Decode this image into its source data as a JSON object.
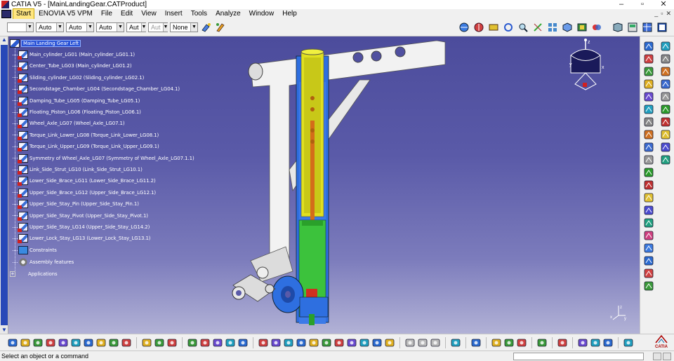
{
  "window": {
    "title": "CATIA V5 - [MainLandingGear.CATProduct]",
    "controls": [
      "–",
      "▫",
      "✕"
    ]
  },
  "menu": {
    "items": [
      "Start",
      "ENOVIA V5 VPM",
      "File",
      "Edit",
      "View",
      "Insert",
      "Tools",
      "Analyze",
      "Window",
      "Help"
    ],
    "doc_controls": [
      "_",
      "▫",
      "✕"
    ]
  },
  "properties_toolbar": {
    "color_combo": "",
    "transparency_combo": "Auto",
    "line_thickness_combo": "Auto",
    "line_type_combo": "Auto",
    "layer_combo": "Aut",
    "render_combo": "Aut",
    "layer_name_combo": "None"
  },
  "tree": {
    "root": "Main Landing Gear Left",
    "items": [
      "Main_cylinder_LG01 (Main_cylinder_LG01.1)",
      "Center_Tube_LG03 (Main_cylinder_LG01.2)",
      "Sliding_cylinder_LG02 (Sliding_cylinder_LG02.1)",
      "Secondstage_Chamber_LG04 (Secondstage_Chamber_LG04.1)",
      "Damping_Tube_LG05 (Damping_Tube_LG05.1)",
      "Floating_Piston_LG06 (Floating_Piston_LG06.1)",
      "Wheel_Axle_LG07 (Wheel_Axle_LG07.1)",
      "Torque_Link_Lower_LG08 (Torque_Link_Lower_LG08.1)",
      "Torque_Link_Upper_LG09 (Torque_Link_Upper_LG09.1)",
      "Symmetry of Wheel_Axle_LG07 (Symmetry of Wheel_Axle_LG07.1.1)",
      "Link_Side_Strut_LG10 (Link_Side_Strut_LG10.1)",
      "Lower_Side_Brace_LG11 (Lower_Side_Brace_LG11.2)",
      "Upper_Side_Brace_LG12 (Upper_Side_Brace_LG12.1)",
      "Upper_Side_Stay_Pin (Upper_Side_Stay_Pin.1)",
      "Upper_Side_Stay_Pivot (Upper_Side_Stay_Pivot.1)",
      "Upper_Side_Stay_LG14 (Upper_Side_Stay_LG14.2)",
      "Lower_Lock_Stay_LG13 (Lower_Lock_Stay_LG13.1)"
    ],
    "constraints": "Constraints",
    "assembly_features": "Assembly features",
    "applications": "Applications"
  },
  "compass": {
    "axis_x": "x",
    "axis_y": "y",
    "axis_z": "z"
  },
  "viewport_axis": {
    "x": "x",
    "y": "y",
    "z": "z"
  },
  "status": {
    "message": "Select an object or a command",
    "command_input": ""
  },
  "logo_text": "CATIA",
  "colors": {
    "viewport_top": "#4c4c9c",
    "viewport_bottom": "#b2b2d6",
    "selection": "#2c55d8",
    "cylinder_blue": "#2e6fe0",
    "inner_yellow": "#e0e020",
    "piston_green": "#3cc23c",
    "frame_white": "#f0f0f0"
  }
}
